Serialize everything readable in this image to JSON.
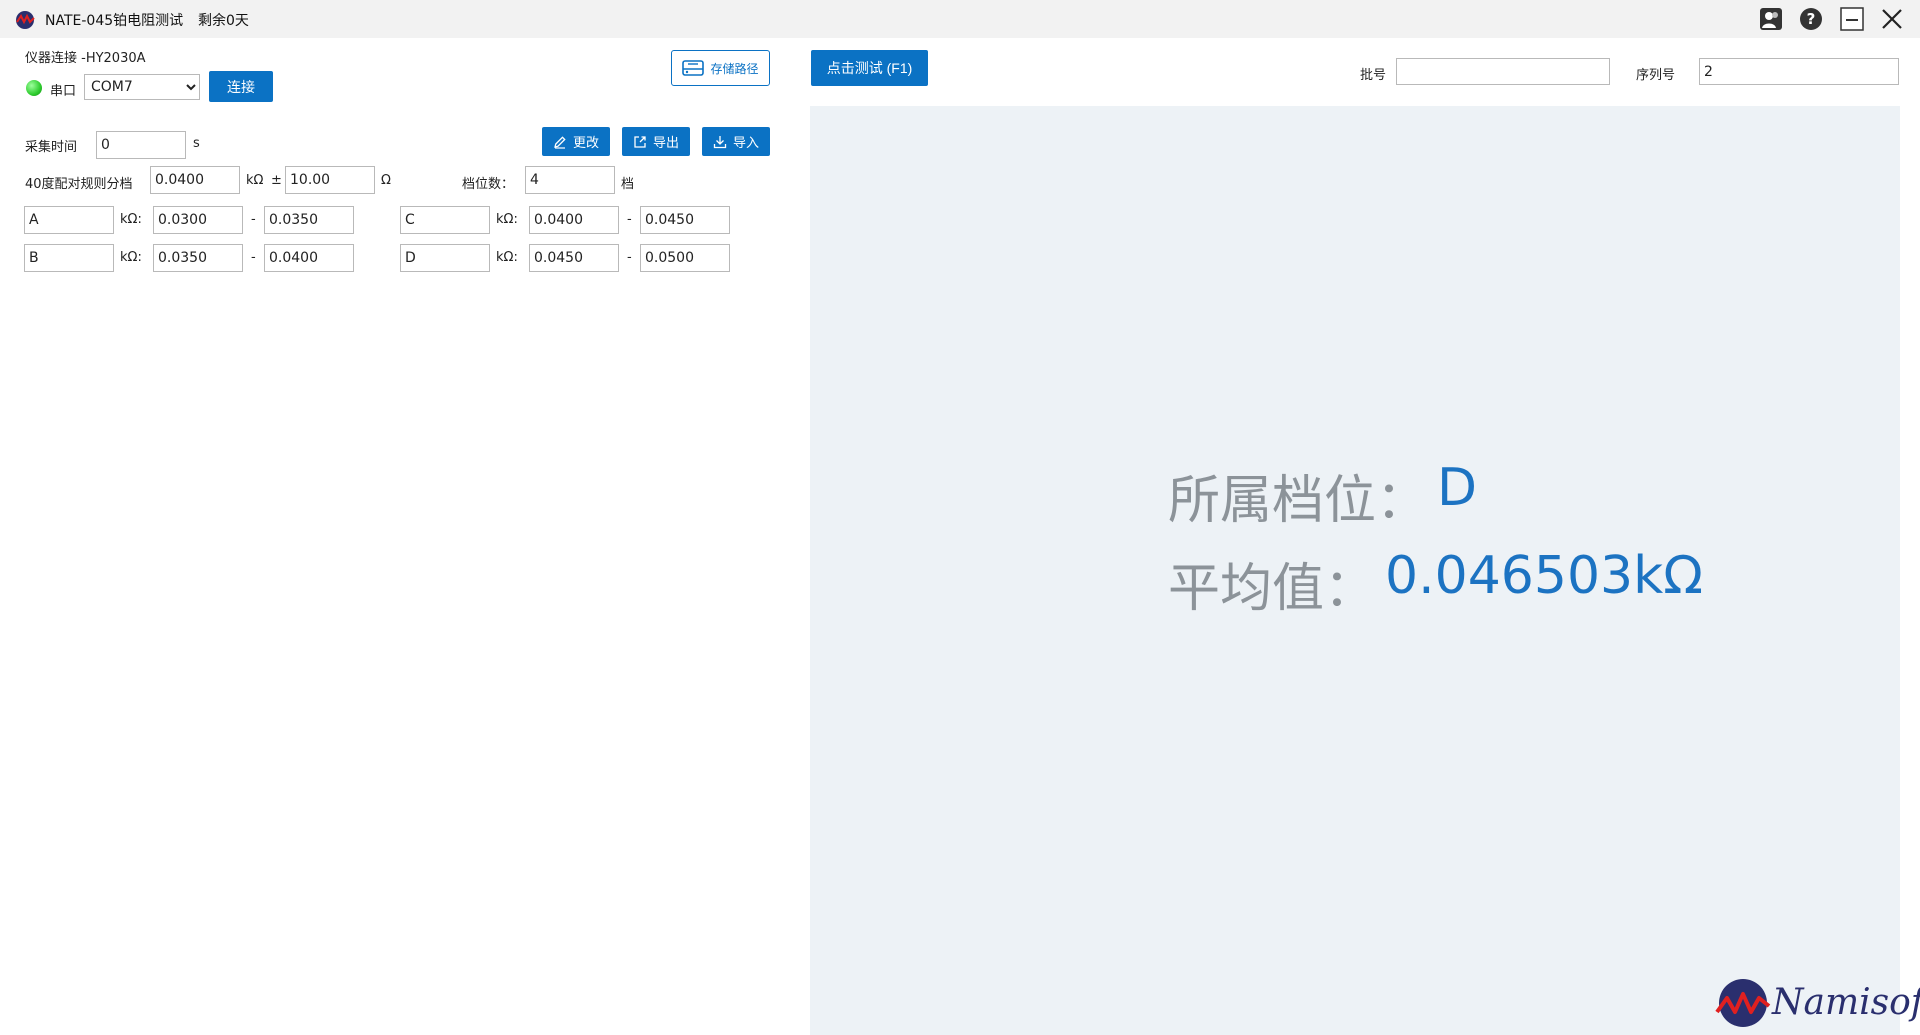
{
  "window": {
    "title": "NATE-045铂电阻测试",
    "remaining": "剩余0天"
  },
  "connection": {
    "heading": "仪器连接 -HY2030A",
    "port_label": "串口",
    "port_value": "COM7",
    "connect_label": "连接",
    "status_color": "#2ecc2e"
  },
  "storage_path_label": "存储路径",
  "test_button_label": "点击测试 (F1)",
  "batch": {
    "label": "批号",
    "value": ""
  },
  "serial": {
    "label": "序列号",
    "value": "2"
  },
  "acquire": {
    "label": "采集时间",
    "value": "0",
    "unit": "s"
  },
  "actions": {
    "modify": "更改",
    "export": "导出",
    "import": "导入"
  },
  "rule": {
    "label": "40度配对规则分档",
    "value": "0.0400",
    "unit": "kΩ",
    "pm": "±",
    "tolerance": "10.00",
    "tolerance_unit": "Ω",
    "levels_label": "档位数：",
    "levels_value": "4",
    "levels_unit": "档"
  },
  "bins": [
    {
      "name": "A",
      "unit": "kΩ:",
      "min": "0.0300",
      "dash": "-",
      "max": "0.0350"
    },
    {
      "name": "B",
      "unit": "kΩ:",
      "min": "0.0350",
      "dash": "-",
      "max": "0.0400"
    },
    {
      "name": "C",
      "unit": "kΩ:",
      "min": "0.0400",
      "dash": "-",
      "max": "0.0450"
    },
    {
      "name": "D",
      "unit": "kΩ:",
      "min": "0.0450",
      "dash": "-",
      "max": "0.0500"
    }
  ],
  "result": {
    "bin_label": "所属档位：",
    "bin_value": "D",
    "avg_label": "平均值：",
    "avg_value": "0.046503kΩ"
  },
  "brand": {
    "logo_text": "Namisoft"
  },
  "colors": {
    "accent": "#0b72c4",
    "panel": "#edf2f6",
    "result_value": "#1c73c2"
  }
}
